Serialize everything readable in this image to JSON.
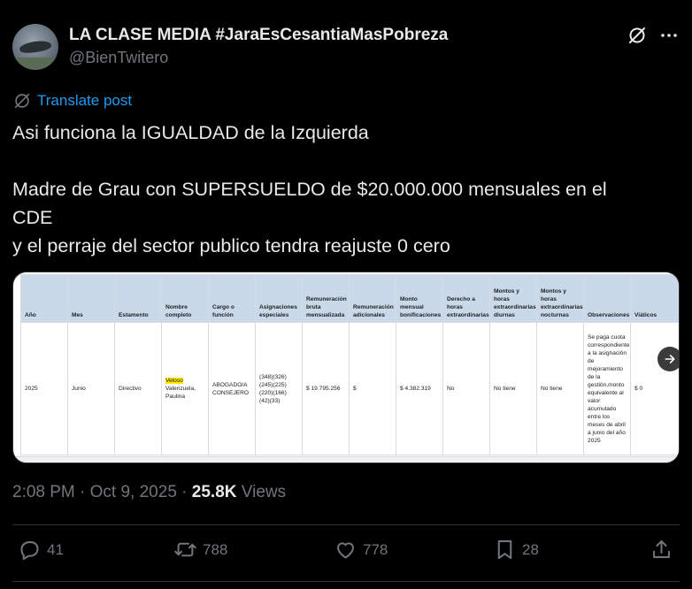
{
  "post": {
    "display_name": "LA CLASE MEDIA #JaraEsCesantiaMasPobreza",
    "handle": "@BienTwitero",
    "translate_label": "Translate post",
    "text_lines": [
      "Asi funciona la IGUALDAD de la Izquierda",
      "",
      "Madre de Grau con SUPERSUELDO de  $20.000.000 mensuales en el",
      "CDE",
      "y el perraje del sector publico tendra reajuste 0 cero"
    ],
    "time": "2:08 PM",
    "date": "Oct 9, 2025",
    "views_count": "25.8K",
    "views_label": "Views"
  },
  "media_table": {
    "headers": [
      "Año",
      "Mes",
      "Estamento",
      "Nombre completo",
      "Cargo o función",
      "Asignaciones especiales",
      "Remuneración bruta mensualizada",
      "Remuneración adicionales",
      "Monto mensual bonificaciones",
      "Derecho a horas extraordinarias",
      "Montos y horas extraordinarias diurnas",
      "Montos y horas extraordinarias nocturnas",
      "Observaciones",
      "Viáticos"
    ],
    "row": {
      "anio": "2025",
      "mes": "Junio",
      "estamento": "Directivo",
      "nombre_highlight": "Veloso",
      "nombre_rest": "Valenzuela, Paulina",
      "cargo": "ABOGADO/A CONSEJERO",
      "asignaciones": "(348)(326) (245)(225) (220)(166) (42)(33)",
      "bruta": "$ 19.795.256",
      "adicionales": "$",
      "bonificaciones": "$ 4.382.319",
      "derecho_horas": "No",
      "diurnas": "No tiene",
      "nocturnas": "No tiene",
      "observaciones": "Se paga cuota correspondiente a la asignación de mejoramiento de la gestión,monto equivalente al valor acumulado entre los meses de abril a junio del año 2025",
      "viaticos": "$ 0"
    }
  },
  "actions": {
    "replies": "41",
    "reposts": "788",
    "likes": "778",
    "bookmarks": "28"
  },
  "icons": [
    "grok-icon",
    "more-icon",
    "translate-icon",
    "next-arrow-icon",
    "reply-icon",
    "repost-icon",
    "like-icon",
    "bookmark-icon",
    "share-icon"
  ],
  "colors": {
    "background": "#000000",
    "text": "#e7e9ea",
    "muted": "#71767b",
    "link": "#1d9bf0",
    "table_header": "#c9d9ea",
    "highlight": "#ffe600"
  }
}
